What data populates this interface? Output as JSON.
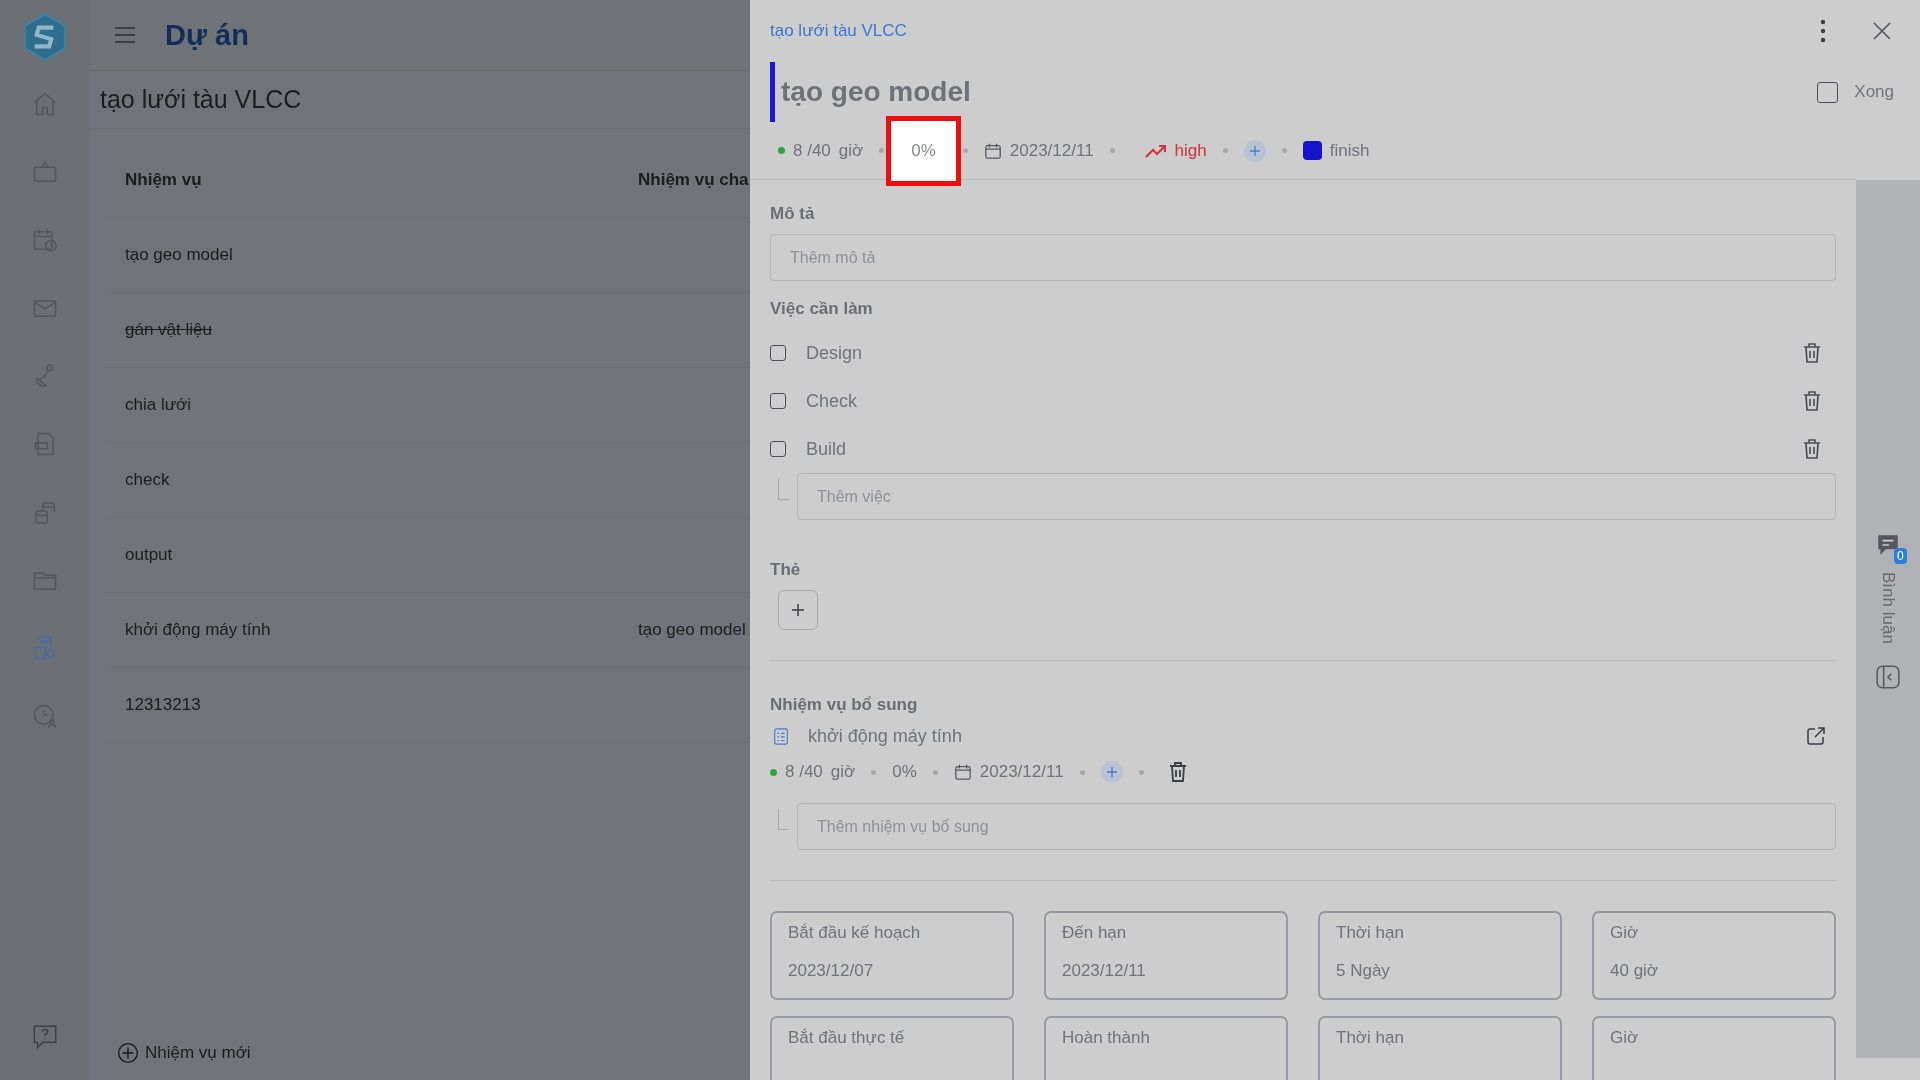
{
  "sidebar": {
    "items": [
      {
        "selected": false
      },
      {
        "selected": false
      },
      {
        "selected": false
      },
      {
        "selected": false
      },
      {
        "selected": false
      },
      {
        "selected": false
      },
      {
        "selected": false
      },
      {
        "selected": false
      },
      {
        "selected": true
      },
      {
        "selected": false
      }
    ]
  },
  "header": {
    "title": "Dự án",
    "project": "tạo lưới tàu VLCC"
  },
  "table": {
    "columns": [
      "Nhiệm vụ",
      "Nhiệm vụ cha"
    ],
    "rows": [
      {
        "task": "tạo geo model",
        "done": false
      },
      {
        "task": "gán vật liệu",
        "done": true
      },
      {
        "task": "chia lưới",
        "done": false
      },
      {
        "task": "check",
        "done": false
      },
      {
        "task": "output",
        "done": false
      },
      {
        "task": "khởi động máy tính",
        "parent": "tạo geo model",
        "done": false
      },
      {
        "task": "12313213",
        "done": false
      }
    ]
  },
  "new_task": "Nhiệm vụ mới",
  "panel": {
    "breadcrumb": "tạo lưới tàu VLCC",
    "title": "tạo geo model",
    "done": {
      "label": "Xong",
      "checked": false
    },
    "meta": {
      "hours": "8 /40",
      "unit": "giờ",
      "progress": {
        "text": "0%",
        "highlighted": true
      },
      "due": "2023/12/11",
      "priority": "high",
      "status": {
        "label": "finish",
        "color": "#1414cc"
      }
    },
    "description": {
      "label": "Mô tả",
      "placeholder": "Thêm mô tả"
    },
    "todo": {
      "label": "Việc cần làm",
      "items": [
        {
          "text": "Design",
          "checked": false
        },
        {
          "text": "Check",
          "checked": false
        },
        {
          "text": "Build",
          "checked": false
        }
      ],
      "placeholder": "Thêm việc"
    },
    "tags": {
      "label": "Thẻ"
    },
    "subtasks": {
      "label": "Nhiệm vụ bổ sung",
      "items": [
        {
          "title": "khởi động máy tính",
          "hours": "8 /40",
          "unit": "giờ",
          "progress": "0%",
          "due": "2023/12/11"
        }
      ],
      "placeholder": "Thêm nhiệm vụ bổ sung"
    },
    "dates": [
      {
        "label": "Bắt đầu kế hoạch",
        "value": "2023/12/07"
      },
      {
        "label": "Đến hạn",
        "value": "2023/12/11"
      },
      {
        "label": "Thời hạn",
        "value": "5 Ngày"
      },
      {
        "label": "Giờ",
        "value": "40 giờ"
      },
      {
        "label": "Bắt đầu thực tế"
      },
      {
        "label": "Hoàn thành"
      },
      {
        "label": "Thời hạn"
      },
      {
        "label": "Giờ"
      }
    ],
    "comments": {
      "label": "Bình luận",
      "count": "0"
    }
  }
}
